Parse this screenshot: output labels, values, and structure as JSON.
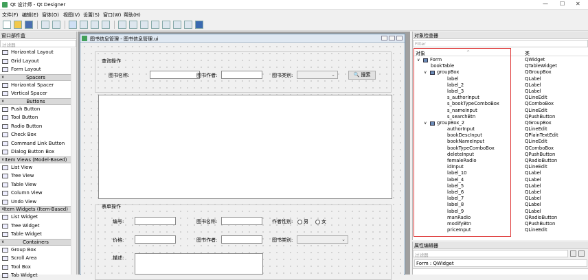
{
  "window": {
    "title": "Qt 设计师 - Qt Designer",
    "minimize": "—",
    "maximize": "☐",
    "close": "✕"
  },
  "menu": [
    "文件(F)",
    "编辑(E)",
    "窗体(O)",
    "视图(V)",
    "设置(S)",
    "窗口(W)",
    "帮助(H)"
  ],
  "widget_box": {
    "title": "窗口部件盒",
    "filter_placeholder": "过滤器",
    "items": [
      {
        "type": "item",
        "label": "Horizontal Layout"
      },
      {
        "type": "item",
        "label": "Grid Layout"
      },
      {
        "type": "item",
        "label": "Form Layout"
      },
      {
        "type": "cat",
        "label": "Spacers"
      },
      {
        "type": "item",
        "label": "Horizontal Spacer"
      },
      {
        "type": "item",
        "label": "Vertical Spacer"
      },
      {
        "type": "cat",
        "label": "Buttons"
      },
      {
        "type": "item",
        "label": "Push Button"
      },
      {
        "type": "item",
        "label": "Tool Button"
      },
      {
        "type": "item",
        "label": "Radio Button"
      },
      {
        "type": "item",
        "label": "Check Box"
      },
      {
        "type": "item",
        "label": "Command Link Button"
      },
      {
        "type": "item",
        "label": "Dialog Button Box"
      },
      {
        "type": "cat",
        "label": "Item Views (Model-Based)"
      },
      {
        "type": "item",
        "label": "List View"
      },
      {
        "type": "item",
        "label": "Tree View"
      },
      {
        "type": "item",
        "label": "Table View"
      },
      {
        "type": "item",
        "label": "Column View"
      },
      {
        "type": "item",
        "label": "Undo View"
      },
      {
        "type": "cat",
        "label": "Item Widgets (Item-Based)"
      },
      {
        "type": "item",
        "label": "List Widget"
      },
      {
        "type": "item",
        "label": "Tree Widget"
      },
      {
        "type": "item",
        "label": "Table Widget"
      },
      {
        "type": "cat",
        "label": "Containers"
      },
      {
        "type": "item",
        "label": "Group Box"
      },
      {
        "type": "item",
        "label": "Scroll Area"
      },
      {
        "type": "item",
        "label": "Tool Box"
      },
      {
        "type": "item",
        "label": "Tab Widget"
      }
    ]
  },
  "form_window": {
    "title": "图书信息管理 - 图书信息管理.ui",
    "query_group": {
      "title": "查询操作",
      "name_label": "图书名称:",
      "author_label": "图书作者:",
      "category_label": "图书类别:",
      "search_button": "🔍 搜索"
    },
    "edit_group": {
      "title": "表单操作",
      "id_label": "编号:",
      "name_label": "图书名称:",
      "gender_label": "作者性别:",
      "male": "男",
      "female": "女",
      "price_label": "价格:",
      "author_label": "图书作者:",
      "category_label": "图书类别:",
      "desc_label": "描述:"
    }
  },
  "object_inspector": {
    "title": "对象检查器",
    "filter_placeholder": "Filter",
    "col_object": "对象",
    "col_class": "类",
    "rows": [
      {
        "depth": 0,
        "expand": "∨",
        "icon": true,
        "name": "Form",
        "cls": "QWidget"
      },
      {
        "depth": 1,
        "expand": "",
        "icon": false,
        "name": "bookTable",
        "cls": "QTableWidget"
      },
      {
        "depth": 1,
        "expand": "∨",
        "icon": true,
        "name": "groupBox",
        "cls": "QGroupBox"
      },
      {
        "depth": 2,
        "expand": "",
        "icon": false,
        "name": "label",
        "cls": "QLabel"
      },
      {
        "depth": 2,
        "expand": "",
        "icon": false,
        "name": "label_2",
        "cls": "QLabel"
      },
      {
        "depth": 2,
        "expand": "",
        "icon": false,
        "name": "label_3",
        "cls": "QLabel"
      },
      {
        "depth": 2,
        "expand": "",
        "icon": false,
        "name": "s_authorInput",
        "cls": "QLineEdit"
      },
      {
        "depth": 2,
        "expand": "",
        "icon": false,
        "name": "s_bookTypeComboBox",
        "cls": "QComboBox"
      },
      {
        "depth": 2,
        "expand": "",
        "icon": false,
        "name": "s_nameInput",
        "cls": "QLineEdit"
      },
      {
        "depth": 2,
        "expand": "",
        "icon": false,
        "name": "s_searchBtn",
        "cls": "QPushButton"
      },
      {
        "depth": 1,
        "expand": "∨",
        "icon": true,
        "name": "groupBox_2",
        "cls": "QGroupBox"
      },
      {
        "depth": 2,
        "expand": "",
        "icon": false,
        "name": "authorInput",
        "cls": "QLineEdit"
      },
      {
        "depth": 2,
        "expand": "",
        "icon": false,
        "name": "bookDescInput",
        "cls": "QPlainTextEdit"
      },
      {
        "depth": 2,
        "expand": "",
        "icon": false,
        "name": "bookNameInput",
        "cls": "QLineEdit"
      },
      {
        "depth": 2,
        "expand": "",
        "icon": false,
        "name": "bookTypeComboBox",
        "cls": "QComboBox"
      },
      {
        "depth": 2,
        "expand": "",
        "icon": false,
        "name": "deleteInput",
        "cls": "QPushButton"
      },
      {
        "depth": 2,
        "expand": "",
        "icon": false,
        "name": "femaleRadio",
        "cls": "QRadioButton"
      },
      {
        "depth": 2,
        "expand": "",
        "icon": false,
        "name": "idInput",
        "cls": "QLineEdit"
      },
      {
        "depth": 2,
        "expand": "",
        "icon": false,
        "name": "label_10",
        "cls": "QLabel"
      },
      {
        "depth": 2,
        "expand": "",
        "icon": false,
        "name": "label_4",
        "cls": "QLabel"
      },
      {
        "depth": 2,
        "expand": "",
        "icon": false,
        "name": "label_5",
        "cls": "QLabel"
      },
      {
        "depth": 2,
        "expand": "",
        "icon": false,
        "name": "label_6",
        "cls": "QLabel"
      },
      {
        "depth": 2,
        "expand": "",
        "icon": false,
        "name": "label_7",
        "cls": "QLabel"
      },
      {
        "depth": 2,
        "expand": "",
        "icon": false,
        "name": "label_8",
        "cls": "QLabel"
      },
      {
        "depth": 2,
        "expand": "",
        "icon": false,
        "name": "label_9",
        "cls": "QLabel"
      },
      {
        "depth": 2,
        "expand": "",
        "icon": false,
        "name": "manRadio",
        "cls": "QRadioButton"
      },
      {
        "depth": 2,
        "expand": "",
        "icon": false,
        "name": "modifyBtn",
        "cls": "QPushButton"
      },
      {
        "depth": 2,
        "expand": "",
        "icon": false,
        "name": "priceInput",
        "cls": "QLineEdit"
      }
    ]
  },
  "property_editor": {
    "title": "属性编辑器",
    "filter_placeholder": "过滤器",
    "class_label": "Form : QWidget"
  },
  "colors": {
    "highlight_border": "#dd3333",
    "mdi_title": "#dfe8f2"
  }
}
